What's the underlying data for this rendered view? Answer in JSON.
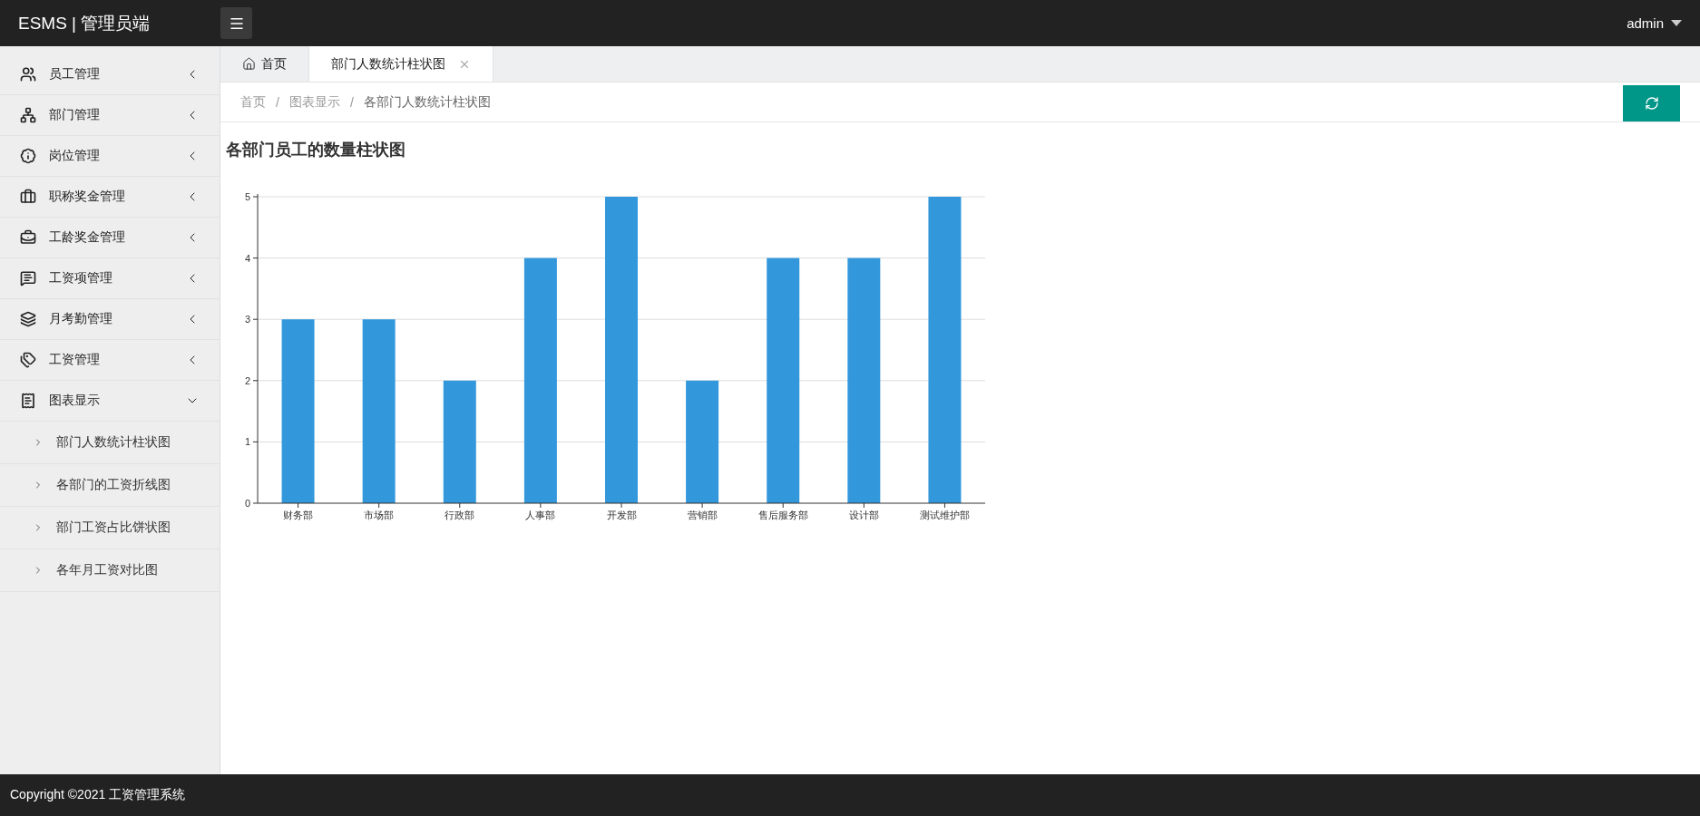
{
  "header": {
    "logo": "ESMS | 管理员端",
    "user": "admin"
  },
  "sidebar": {
    "items": [
      {
        "label": "员工管理",
        "expanded": false
      },
      {
        "label": "部门管理",
        "expanded": false
      },
      {
        "label": "岗位管理",
        "expanded": false
      },
      {
        "label": "职称奖金管理",
        "expanded": false
      },
      {
        "label": "工龄奖金管理",
        "expanded": false
      },
      {
        "label": "工资项管理",
        "expanded": false
      },
      {
        "label": "月考勤管理",
        "expanded": false
      },
      {
        "label": "工资管理",
        "expanded": false
      },
      {
        "label": "图表显示",
        "expanded": true,
        "children": [
          {
            "label": "部门人数统计柱状图"
          },
          {
            "label": "各部门的工资折线图"
          },
          {
            "label": "部门工资占比饼状图"
          },
          {
            "label": "各年月工资对比图"
          }
        ]
      }
    ]
  },
  "tabs": [
    {
      "label": "首页",
      "kind": "home",
      "selected": false
    },
    {
      "label": "部门人数统计柱状图",
      "kind": "closable",
      "selected": true
    }
  ],
  "breadcrumb": {
    "separator": "/",
    "items": [
      "首页",
      "图表显示",
      "各部门人数统计柱状图"
    ]
  },
  "chart": {
    "title": "各部门员工的数量柱状图",
    "chart_data": {
      "type": "bar",
      "categories": [
        "财务部",
        "市场部",
        "行政部",
        "人事部",
        "开发部",
        "营销部",
        "售后服务部",
        "设计部",
        "测试维护部"
      ],
      "series": [
        {
          "color": "#3398db",
          "values": [
            3,
            3,
            2,
            4,
            5,
            2,
            4,
            4,
            5
          ]
        }
      ],
      "ylim": [
        0,
        5
      ],
      "yticks": [
        0,
        1,
        2,
        3,
        4,
        5
      ],
      "grid": true
    }
  },
  "footer": "Copyright ©2021 工资管理系统"
}
